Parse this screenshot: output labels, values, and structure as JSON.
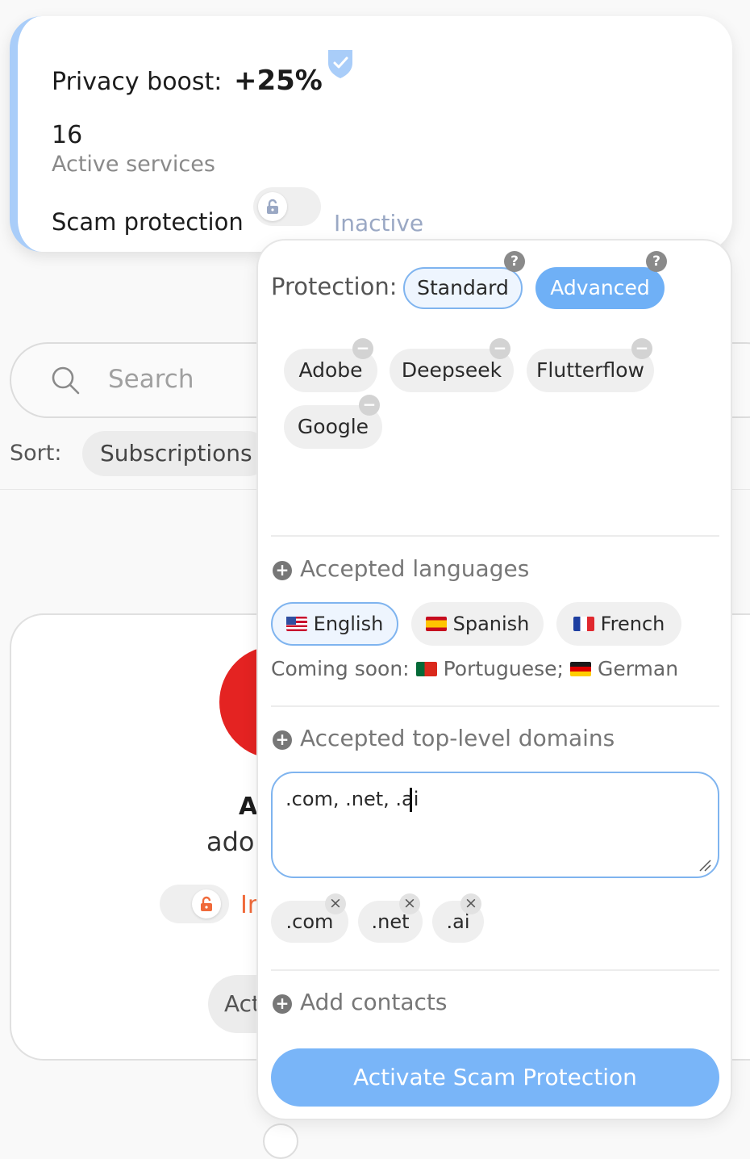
{
  "summary": {
    "privacy_boost_label": "Privacy boost:",
    "privacy_boost_value": "+25%",
    "active_count": "16",
    "active_label": "Active services",
    "scam_protection_label": "Scam protection",
    "scam_protection_status": "Inactive",
    "scam_protection_enabled": false
  },
  "background": {
    "search_placeholder": "Search",
    "sort_label": "Sort:",
    "sort_value": "Subscriptions",
    "service_title_partial": "A",
    "service_domain_partial": "ado",
    "service_status_partial": "Ir",
    "service_action_partial": "Act"
  },
  "panel": {
    "protection_label": "Protection:",
    "modes": [
      {
        "label": "Standard",
        "selected": false,
        "help": "?"
      },
      {
        "label": "Advanced",
        "selected": true,
        "help": "?"
      }
    ],
    "services": [
      {
        "label": "Adobe",
        "remove": "−"
      },
      {
        "label": "Deepseek",
        "remove": "−"
      },
      {
        "label": "Flutterflow",
        "remove": "−"
      },
      {
        "label": "Google",
        "remove": "−"
      }
    ],
    "languages_title": "Accepted languages",
    "languages": [
      {
        "label": "English",
        "flag": "us-flag-icon",
        "selected": true
      },
      {
        "label": "Spanish",
        "flag": "es-flag-icon",
        "selected": false
      },
      {
        "label": "French",
        "flag": "fr-flag-icon",
        "selected": false
      }
    ],
    "coming_soon_label": "Coming soon:",
    "coming_soon_languages": [
      "Portuguese;",
      "German"
    ],
    "tld_title": "Accepted top-level domains",
    "tld_input_value": ".com, .net, .ai",
    "tld_chips": [
      {
        "label": ".com",
        "remove": "×"
      },
      {
        "label": ".net",
        "remove": "×"
      },
      {
        "label": ".ai",
        "remove": "×"
      }
    ],
    "contacts_title": "Add contacts",
    "plus_glyph": "+",
    "activate_label": "Activate Scam Protection"
  },
  "colors": {
    "accent": "#6fb0f6",
    "accent_border": "#7fb4ef",
    "inactive_text": "#9aa8c4",
    "adobe_red": "#e42322",
    "warning_orange": "#f06a3a"
  }
}
